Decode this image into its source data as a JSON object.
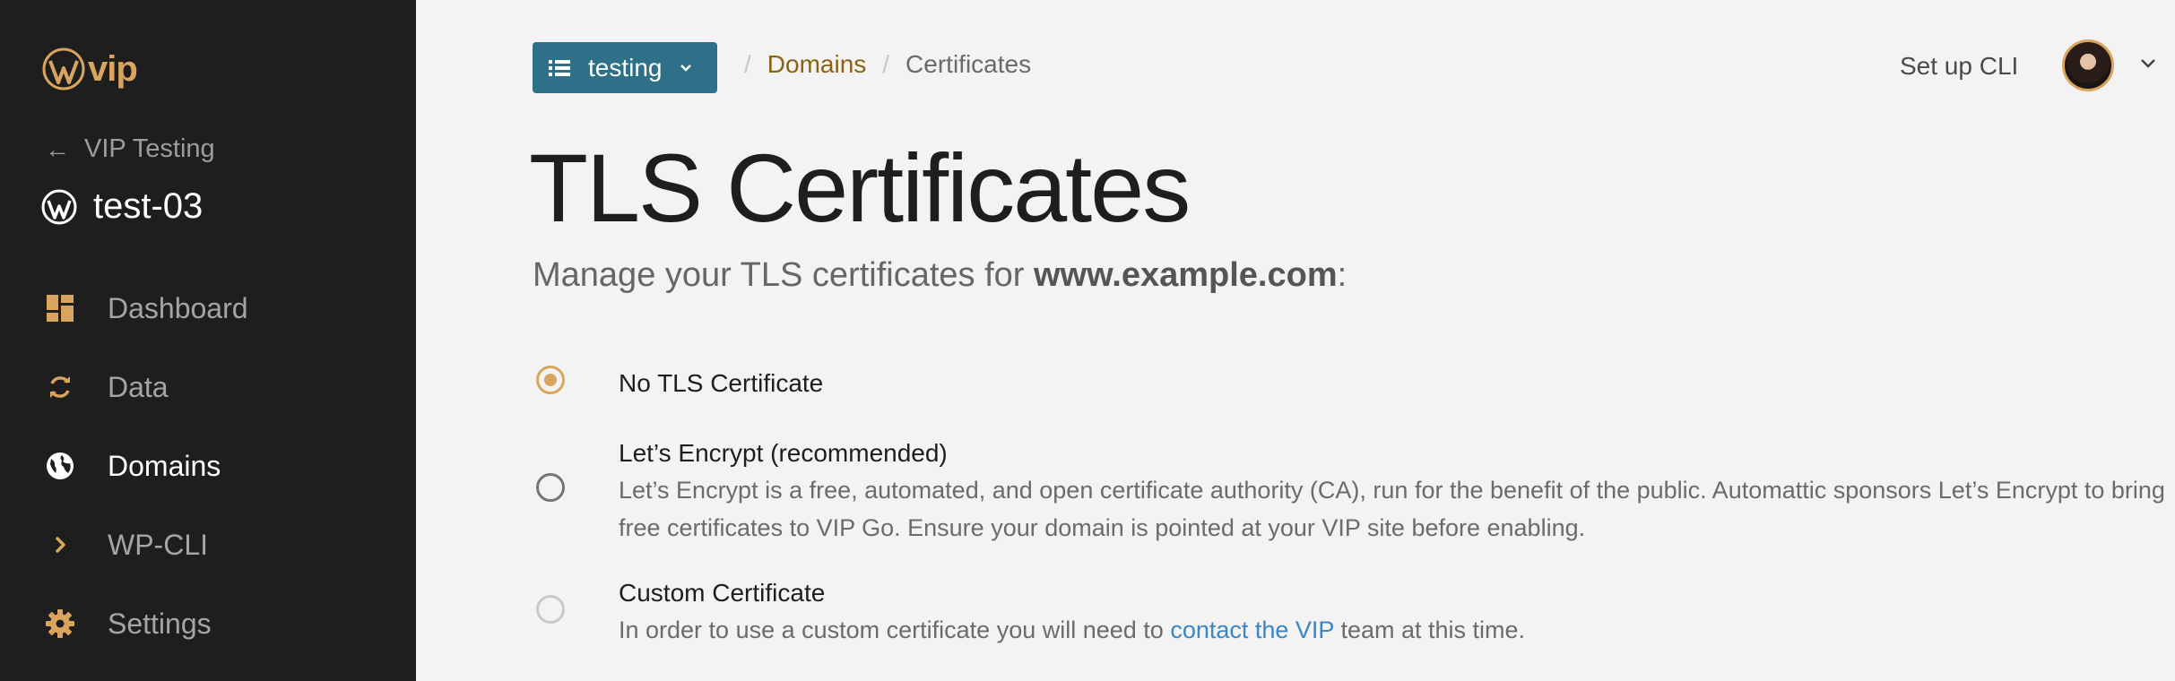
{
  "brand": {
    "logo_text": "vip",
    "accent": "#d9a55e"
  },
  "sidebar": {
    "back_label": "VIP Testing",
    "site_name": "test-03",
    "items": [
      {
        "label": "Dashboard",
        "icon": "dashboard-icon"
      },
      {
        "label": "Data",
        "icon": "sync-icon"
      },
      {
        "label": "Domains",
        "icon": "globe-icon",
        "active": true
      },
      {
        "label": "WP-CLI",
        "icon": "chevron-right-icon"
      },
      {
        "label": "Settings",
        "icon": "gear-icon"
      }
    ]
  },
  "header": {
    "site_switcher": "testing",
    "breadcrumb": {
      "parent": "Domains",
      "current": "Certificates"
    },
    "setup_cli": "Set up CLI"
  },
  "main": {
    "title": "TLS Certificates",
    "subtitle_prefix": "Manage your TLS certificates for ",
    "subtitle_domain": "www.example.com",
    "subtitle_suffix": ":",
    "options": [
      {
        "title": "No TLS Certificate",
        "selected": true
      },
      {
        "title": "Let’s Encrypt (recommended)",
        "description": "Let’s Encrypt is a free, automated, and open certificate authority (CA), run for the benefit of the public. Automattic sponsors Let’s Encrypt to bring free certificates to VIP Go. Ensure your domain is pointed at your VIP site before enabling."
      },
      {
        "title": "Custom Certificate",
        "disabled": true,
        "description_prefix": "In order to use a custom certificate you will need to ",
        "description_link": "contact the VIP",
        "description_suffix": " team at this time."
      }
    ]
  }
}
